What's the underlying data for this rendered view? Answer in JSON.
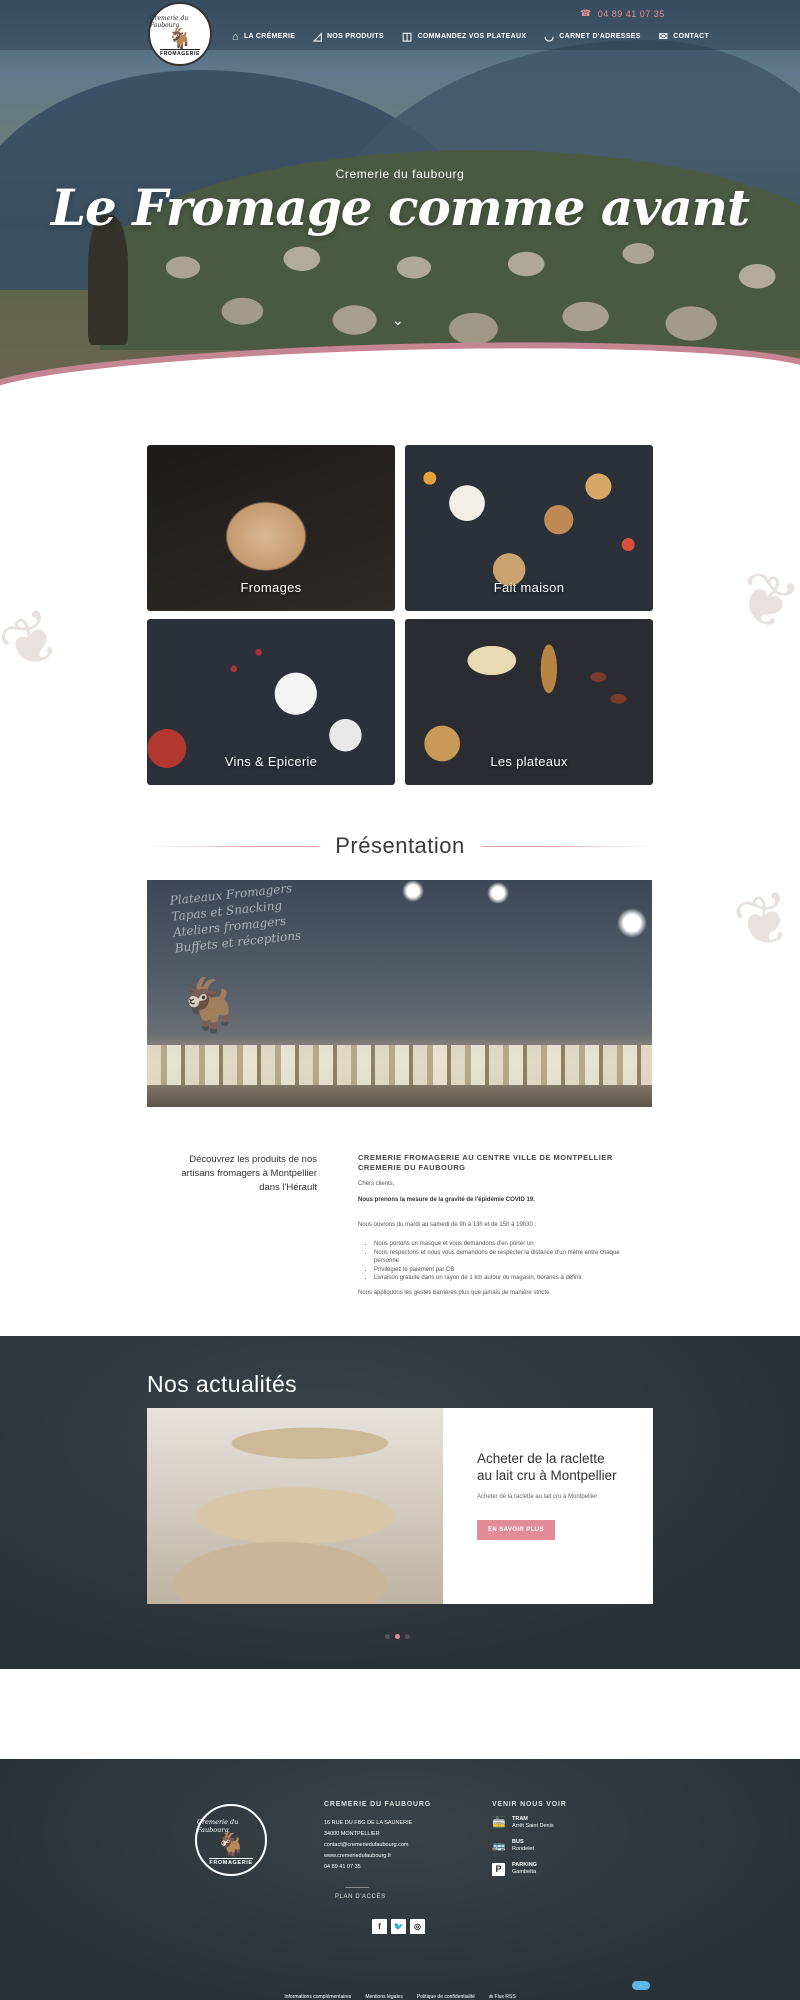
{
  "header": {
    "phone": "04 89 41 07 35",
    "logo": {
      "top_text": "Cremerie du Faubourg",
      "bottom_text": "FROMAGERIE"
    },
    "nav": [
      {
        "label": "LA CRÉMERIE",
        "icon": "shop-icon"
      },
      {
        "label": "NOS PRODUITS",
        "icon": "cheese-icon"
      },
      {
        "label": "COMMANDEZ VOS PLATEAUX",
        "icon": "platter-icon"
      },
      {
        "label": "CARNET D'ADRESSES",
        "icon": "basket-icon"
      },
      {
        "label": "CONTACT",
        "icon": "contact-icon"
      }
    ]
  },
  "hero": {
    "subtitle": "Cremerie du faubourg",
    "title": "Le Fromage comme avant"
  },
  "categories": [
    {
      "label": "Fromages"
    },
    {
      "label": "Fait maison"
    },
    {
      "label": "Vins & Epicerie"
    },
    {
      "label": "Les plateaux"
    }
  ],
  "presentation": {
    "heading": "Présentation",
    "image_text": [
      "Plateaux Fromagers",
      "Tapas et Snacking",
      "Ateliers fromagers",
      "Buffets et réceptions"
    ],
    "intro": "Découvrez les produits de nos artisans fromagers à Montpellier dans l'Hérault",
    "title": "CREMERIE FROMAGERIE AU CENTRE VILLE DE MONTPELLIER CREMERIE DU FAUBOURG",
    "p1": "Chers clients,",
    "p2": "Nous prenons la mesure de la gravité de l'épidémie COVID 19.",
    "p3": "Nous ouvrons du mardi au samedi de 9h à 13h et de 15h à 19h30 :",
    "bullets": [
      "Nous portons un masque et vous demandons d'en porter un",
      "Nous respectons et nous vous demandons de respecter la distance d'un mètre entre chaque personne",
      "Privilégiez le paiement par CB",
      "Livraison gratuite dans un rayon de 1 km autour du magasin, horaires à définir."
    ],
    "p4": "Nous appliquons les gestes barrières plus que jamais de manière stricte."
  },
  "news": {
    "heading": "Nos actualités",
    "card_title": "Acheter de la raclette au lait cru à Montpellier",
    "card_text": "Acheter de la raclette au lait cru à Montpellier",
    "button": "EN SAVOIR PLUS"
  },
  "footer": {
    "col1_title": "CREMERIE DU FAUBOURG",
    "address1": "16 RUE DU FBG DE LA SAUNERIE",
    "address2": "34000 MONTPELLIER",
    "email": "contact@cremeriedufaubourg.com",
    "website": "www.cremeriedufaubourg.fr",
    "phone": "04 89 41 07 35",
    "plan": "PLAN D'ACCÈS",
    "col2_title": "VENIR NOUS VOIR",
    "transit": [
      {
        "label": "TRAM",
        "value": "Arrêt Saint Denis"
      },
      {
        "label": "BUS",
        "value": "Rondelet"
      },
      {
        "label": "PARKING",
        "value": "Gambetta"
      }
    ],
    "bottom_links": [
      "Informations complémentaires",
      "Mentions légales",
      "Politique de confidentialité",
      "Flux RSS"
    ]
  },
  "colors": {
    "accent": "#e48b98",
    "dark_bg": "#2e3539"
  }
}
